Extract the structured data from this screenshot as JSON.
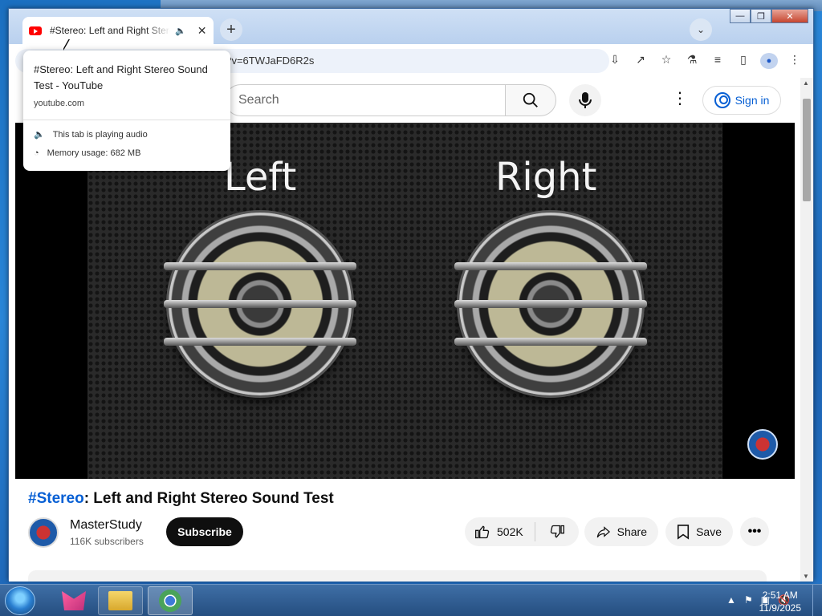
{
  "browser": {
    "tab_title": "#Stereo: Left and Right Stereo Sound Test - YouTube",
    "tab_audio_icon": "speaker-icon",
    "url_visible": "h?v=6TWJaFD6R2s",
    "window_controls": {
      "minimize": "—",
      "maximize": "❐",
      "close": "✕"
    }
  },
  "hover_card": {
    "title": "#Stereo: Left and Right Stereo Sound Test - YouTube",
    "domain": "youtube.com",
    "audio_text": "This tab is playing audio",
    "memory_text": "Memory usage: 682 MB"
  },
  "youtube": {
    "search_placeholder": "Search",
    "sign_in": "Sign in",
    "video": {
      "left_label": "Left",
      "right_label": "Right",
      "title_hashtag": "#Stereo",
      "title_rest": ": Left and Right Stereo Sound Test"
    },
    "channel": {
      "name": "MasterStudy",
      "subscribers": "116K subscribers",
      "subscribe_label": "Subscribe"
    },
    "actions": {
      "likes": "502K",
      "share": "Share",
      "save": "Save"
    }
  },
  "taskbar": {
    "time": "2:51 AM",
    "date": "11/9/2025"
  }
}
